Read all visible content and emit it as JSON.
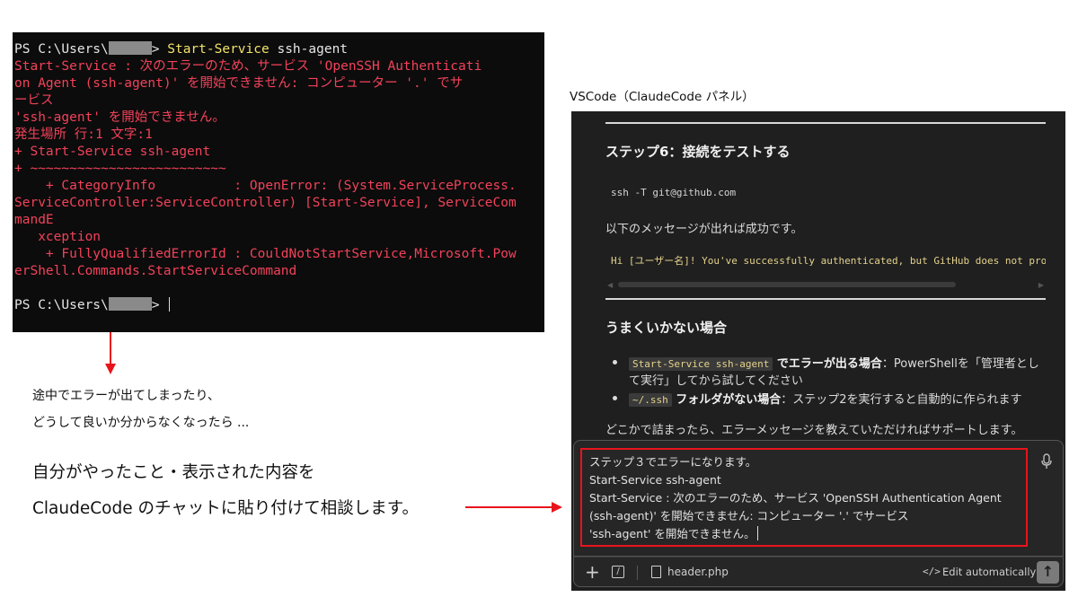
{
  "terminal": {
    "lines": [
      {
        "parts": [
          {
            "t": "PS C:\\Users\\",
            "c": "white"
          },
          {
            "mask": true
          },
          {
            "t": "> ",
            "c": "white"
          },
          {
            "t": "Start-Service",
            "c": "yellow"
          },
          {
            "t": " ssh-agent",
            "c": "white"
          }
        ]
      },
      {
        "parts": [
          {
            "t": "Start-Service : 次のエラーのため、サービス 'OpenSSH Authenticati",
            "c": "red"
          }
        ]
      },
      {
        "parts": [
          {
            "t": "on Agent (ssh-agent)' を開始できません: コンピューター '.' でサ",
            "c": "red"
          }
        ]
      },
      {
        "parts": [
          {
            "t": "ービス",
            "c": "red"
          }
        ]
      },
      {
        "parts": [
          {
            "t": "'ssh-agent' を開始できません。",
            "c": "red"
          }
        ]
      },
      {
        "parts": [
          {
            "t": "発生場所 行:1 文字:1",
            "c": "red"
          }
        ]
      },
      {
        "parts": [
          {
            "t": "+ Start-Service ssh-agent",
            "c": "red"
          }
        ]
      },
      {
        "parts": [
          {
            "t": "+ ~~~~~~~~~~~~~~~~~~~~~~~~~",
            "c": "red"
          }
        ]
      },
      {
        "parts": [
          {
            "t": "    + CategoryInfo          : OpenError: (System.ServiceProcess.",
            "c": "red"
          }
        ]
      },
      {
        "parts": [
          {
            "t": "ServiceController:ServiceController) [Start-Service], ServiceCom",
            "c": "red"
          }
        ]
      },
      {
        "parts": [
          {
            "t": "mandE",
            "c": "red"
          }
        ]
      },
      {
        "parts": [
          {
            "t": "   xception",
            "c": "red"
          }
        ]
      },
      {
        "parts": [
          {
            "t": "    + FullyQualifiedErrorId : CouldNotStartService,Microsoft.Pow",
            "c": "red"
          }
        ]
      },
      {
        "parts": [
          {
            "t": "erShell.Commands.StartServiceCommand",
            "c": "red"
          }
        ]
      },
      {
        "parts": [
          {
            "t": "",
            "c": "white"
          }
        ]
      },
      {
        "parts": [
          {
            "t": "PS C:\\Users\\",
            "c": "white"
          },
          {
            "mask": true
          },
          {
            "t": "> ",
            "c": "white"
          },
          {
            "cursor": true
          }
        ]
      }
    ]
  },
  "notes": {
    "line1": "途中でエラーが出てしまったり、",
    "line2": "どうして良いか分からなくなったら ...",
    "big1": "自分がやったこと・表示された内容を",
    "big2": "ClaudeCode のチャットに貼り付けて相談します。"
  },
  "vscode": {
    "caption": "VSCode（ClaudeCode パネル）",
    "step6_heading": "ステップ6：接続をテストする",
    "ssh_cmd": "ssh -T git@github.com",
    "success_text": "以下のメッセージが出れば成功です。",
    "success_code": "Hi [ユーザー名]! You've successfully authenticated, but GitHub does not provide shell access.",
    "trouble_heading": "うまくいかない場合",
    "bullet1_code": "Start-Service ssh-agent",
    "bullet1_bold": " でエラーが出る場合",
    "bullet1_rest": "：PowerShellを「管理者とし",
    "bullet1_rest2": "て実行」してから試してください",
    "bullet2_code": "~/.ssh",
    "bullet2_bold": " フォルダがない場合",
    "bullet2_rest": "：ステップ2を実行すると自動的に作られます",
    "closing_text": "どこかで詰まったら、エラーメッセージを教えていただければサポートします。",
    "input_lines": [
      "ステップ３でエラーになります。",
      "Start-Service ssh-agent",
      "Start-Service : 次のエラーのため、サービス 'OpenSSH Authentication Agent",
      "(ssh-agent)' を開始できません: コンピューター '.' でサービス",
      "'ssh-agent' を開始できません。"
    ],
    "toolbar": {
      "plus": "+",
      "slash": "/",
      "file_name": "header.php",
      "code_icon": "</>",
      "edit_label": "Edit automatically",
      "send": "↑"
    }
  }
}
